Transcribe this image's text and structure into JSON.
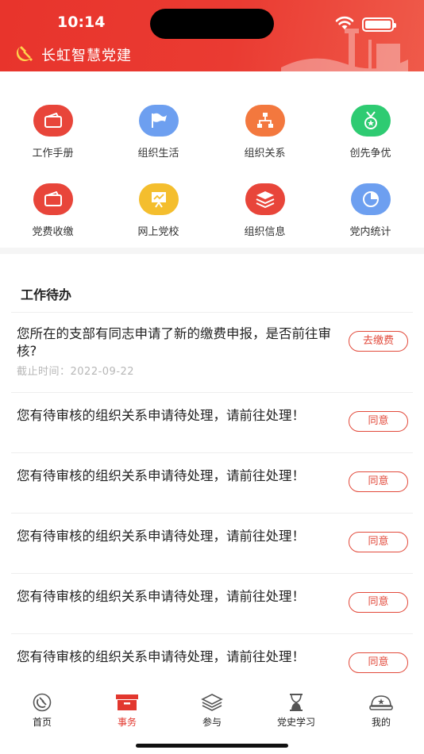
{
  "status_bar": {
    "time": "10:14"
  },
  "header": {
    "title": "长虹智慧党建"
  },
  "grid": [
    {
      "label": "工作手册",
      "icon": "wallet-icon",
      "color": "#e8453a"
    },
    {
      "label": "组织生活",
      "icon": "flag-icon",
      "color": "#6d9ff0"
    },
    {
      "label": "组织关系",
      "icon": "org-chart-icon",
      "color": "#f3783e"
    },
    {
      "label": "创先争优",
      "icon": "medal-icon",
      "color": "#2ecb72"
    },
    {
      "label": "党费收缴",
      "icon": "wallet-icon",
      "color": "#e8453a"
    },
    {
      "label": "网上党校",
      "icon": "presentation-board-icon",
      "color": "#f4be2e"
    },
    {
      "label": "组织信息",
      "icon": "layers-icon",
      "color": "#e8453a"
    },
    {
      "label": "党内统计",
      "icon": "pie-chart-icon",
      "color": "#6d9ff0"
    }
  ],
  "todo": {
    "title": "工作待办",
    "items": [
      {
        "text": "您所在的支部有同志申请了新的缴费申报，是否前往审核?",
        "deadline": "截止时间：2022-09-22",
        "action": "去缴费"
      },
      {
        "text": "您有待审核的组织关系申请待处理，请前往处理！",
        "action": "同意"
      },
      {
        "text": "您有待审核的组织关系申请待处理，请前往处理！",
        "action": "同意"
      },
      {
        "text": "您有待审核的组织关系申请待处理，请前往处理！",
        "action": "同意"
      },
      {
        "text": "您有待审核的组织关系申请待处理，请前往处理！",
        "action": "同意"
      },
      {
        "text": "您有待审核的组织关系申请待处理，请前往处理！",
        "action": "同意"
      }
    ]
  },
  "tabbar": {
    "active": "事务",
    "active_color": "#e2372e",
    "tabs": [
      {
        "label": "首页",
        "icon": "party-emblem-icon"
      },
      {
        "label": "事务",
        "icon": "inbox-icon"
      },
      {
        "label": "参与",
        "icon": "layers-icon"
      },
      {
        "label": "党史学习",
        "icon": "hourglass-icon"
      },
      {
        "label": "我的",
        "icon": "cap-icon"
      }
    ]
  }
}
